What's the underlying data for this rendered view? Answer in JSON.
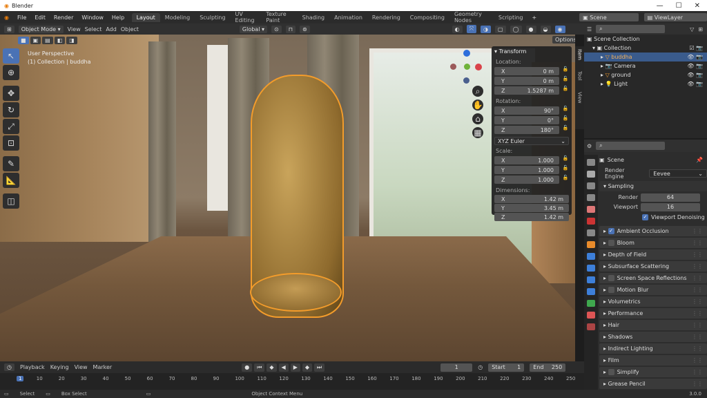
{
  "window": {
    "title": "Blender"
  },
  "menu": [
    "File",
    "Edit",
    "Render",
    "Window",
    "Help"
  ],
  "workspaces": [
    "Layout",
    "Modeling",
    "Sculpting",
    "UV Editing",
    "Texture Paint",
    "Shading",
    "Animation",
    "Rendering",
    "Compositing",
    "Geometry Nodes",
    "Scripting"
  ],
  "active_workspace": "Layout",
  "scene": "Scene",
  "view_layer": "ViewLayer",
  "vp_header": {
    "mode": "Object Mode",
    "view": "View",
    "select": "Select",
    "add": "Add",
    "object": "Object",
    "orientation": "Global",
    "options": "Options"
  },
  "vp_info": {
    "line1": "User Perspective",
    "line2": "(1) Collection | buddha"
  },
  "transform": {
    "title": "Transform",
    "location_label": "Location:",
    "location": [
      {
        "ax": "X",
        "v": "0 m"
      },
      {
        "ax": "Y",
        "v": "0 m"
      },
      {
        "ax": "Z",
        "v": "1.5287 m"
      }
    ],
    "rotation_label": "Rotation:",
    "rotation": [
      {
        "ax": "X",
        "v": "90°"
      },
      {
        "ax": "Y",
        "v": "0°"
      },
      {
        "ax": "Z",
        "v": "180°"
      }
    ],
    "rotation_mode": "XYZ Euler",
    "scale_label": "Scale:",
    "scale": [
      {
        "ax": "X",
        "v": "1.000"
      },
      {
        "ax": "Y",
        "v": "1.000"
      },
      {
        "ax": "Z",
        "v": "1.000"
      }
    ],
    "dimensions_label": "Dimensions:",
    "dimensions": [
      {
        "ax": "X",
        "v": "1.42 m"
      },
      {
        "ax": "Y",
        "v": "3.45 m"
      },
      {
        "ax": "Z",
        "v": "1.42 m"
      }
    ]
  },
  "side_tabs": [
    "Item",
    "Tool",
    "View"
  ],
  "outliner": {
    "root": "Scene Collection",
    "collection": "Collection",
    "items": [
      "buddha",
      "Camera",
      "ground",
      "Light"
    ]
  },
  "props": {
    "context": "Scene",
    "render_engine_label": "Render Engine",
    "render_engine": "Eevee",
    "sampling": "Sampling",
    "render_label": "Render",
    "render_val": "64",
    "viewport_label": "Viewport",
    "viewport_val": "16",
    "viewport_denoising": "Viewport Denoising",
    "sections": [
      {
        "label": "Ambient Occlusion",
        "cb": true,
        "on": true
      },
      {
        "label": "Bloom",
        "cb": true,
        "on": false
      },
      {
        "label": "Depth of Field",
        "cb": false
      },
      {
        "label": "Subsurface Scattering",
        "cb": false
      },
      {
        "label": "Screen Space Reflections",
        "cb": true,
        "on": false
      },
      {
        "label": "Motion Blur",
        "cb": true,
        "on": false
      },
      {
        "label": "Volumetrics",
        "cb": false
      },
      {
        "label": "Performance",
        "cb": false
      },
      {
        "label": "Hair",
        "cb": false
      },
      {
        "label": "Shadows",
        "cb": false
      },
      {
        "label": "Indirect Lighting",
        "cb": false
      },
      {
        "label": "Film",
        "cb": false
      },
      {
        "label": "Simplify",
        "cb": true,
        "on": false
      },
      {
        "label": "Grease Pencil",
        "cb": false
      }
    ]
  },
  "timeline": {
    "playback": "Playback",
    "keying": "Keying",
    "view": "View",
    "marker": "Marker",
    "current": "1",
    "start_label": "Start",
    "start": "1",
    "end_label": "End",
    "end": "250",
    "ticks": [
      "1",
      "10",
      "20",
      "30",
      "40",
      "50",
      "60",
      "70",
      "80",
      "90",
      "100",
      "110",
      "120",
      "130",
      "140",
      "150",
      "160",
      "170",
      "180",
      "190",
      "200",
      "210",
      "220",
      "230",
      "240",
      "250"
    ]
  },
  "status": {
    "select": "Select",
    "box_select": "Box Select",
    "context_menu": "Object Context Menu",
    "version": "3.0.0"
  }
}
